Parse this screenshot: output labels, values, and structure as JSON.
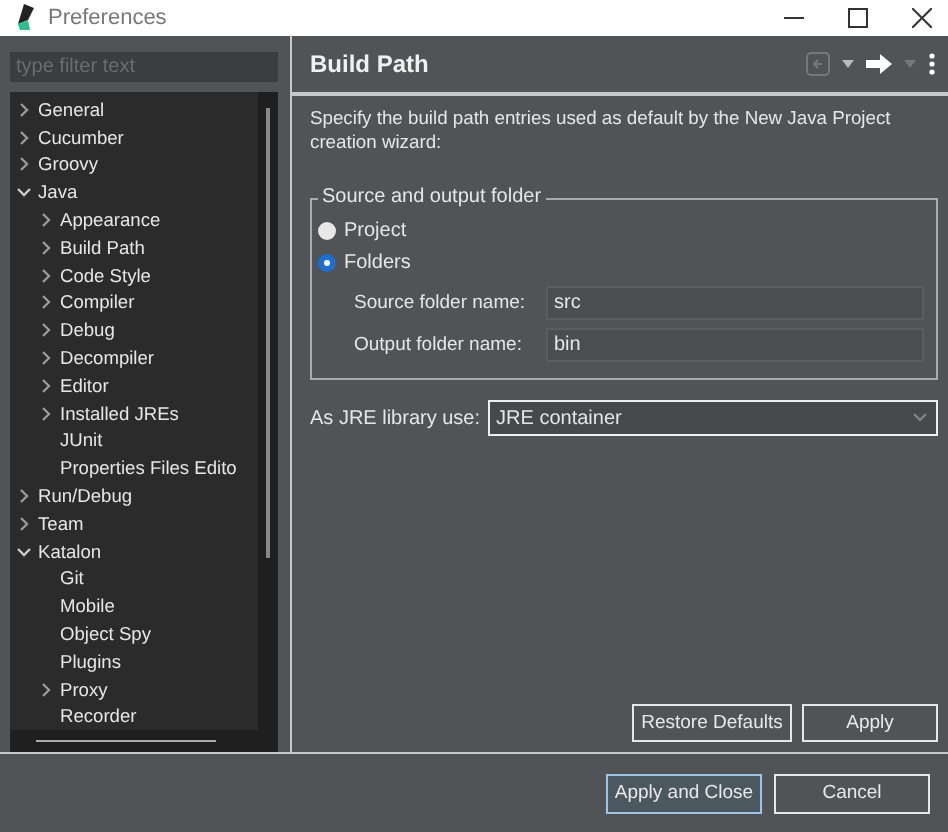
{
  "window": {
    "title": "Preferences"
  },
  "filter": {
    "placeholder": "type filter text"
  },
  "tree": [
    {
      "label": "General",
      "expanded": false,
      "selected": false
    },
    {
      "label": "Cucumber",
      "expanded": false,
      "selected": false
    },
    {
      "label": "Groovy",
      "expanded": false,
      "selected": false
    },
    {
      "label": "Java",
      "expanded": true,
      "selected": false,
      "children": [
        {
          "label": "Appearance",
          "expanded": false,
          "selected": false
        },
        {
          "label": "Build Path",
          "expanded": false,
          "selected": false
        },
        {
          "label": "Code Style",
          "expanded": false,
          "selected": false
        },
        {
          "label": "Compiler",
          "expanded": false,
          "selected": false
        },
        {
          "label": "Debug",
          "expanded": false,
          "selected": false
        },
        {
          "label": "Decompiler",
          "expanded": false,
          "selected": false
        },
        {
          "label": "Editor",
          "expanded": false,
          "selected": false
        },
        {
          "label": "Installed JREs",
          "expanded": false,
          "selected": false
        },
        {
          "label": "JUnit",
          "selected": false
        },
        {
          "label": "Properties Files Edito",
          "selected": false
        }
      ]
    },
    {
      "label": "Run/Debug",
      "expanded": false,
      "selected": false
    },
    {
      "label": "Team",
      "expanded": false,
      "selected": false
    },
    {
      "label": "Katalon",
      "expanded": true,
      "selected": false,
      "children": [
        {
          "label": "Git",
          "selected": false
        },
        {
          "label": "Mobile",
          "selected": false
        },
        {
          "label": "Object Spy",
          "selected": false
        },
        {
          "label": "Plugins",
          "selected": false
        },
        {
          "label": "Proxy",
          "expanded": false,
          "selected": false
        },
        {
          "label": "Recorder",
          "selected": false
        }
      ]
    }
  ],
  "page": {
    "title": "Build Path",
    "description": "Specify the build path entries used as default by the New Java Project creation wizard:",
    "group": {
      "title": "Source and output folder",
      "options": [
        {
          "label": "Project",
          "selected": false
        },
        {
          "label": "Folders",
          "selected": true
        }
      ],
      "fields": [
        {
          "label": "Source folder name:",
          "value": "src"
        },
        {
          "label": "Output folder name:",
          "value": "bin"
        }
      ]
    },
    "jre": {
      "label": "As JRE library use:",
      "value": "JRE container"
    },
    "buttons": [
      "Restore Defaults",
      "Apply"
    ]
  },
  "footer": {
    "buttons": [
      {
        "label": "Apply and Close",
        "focused": true
      },
      {
        "label": "Cancel",
        "focused": false
      }
    ]
  }
}
